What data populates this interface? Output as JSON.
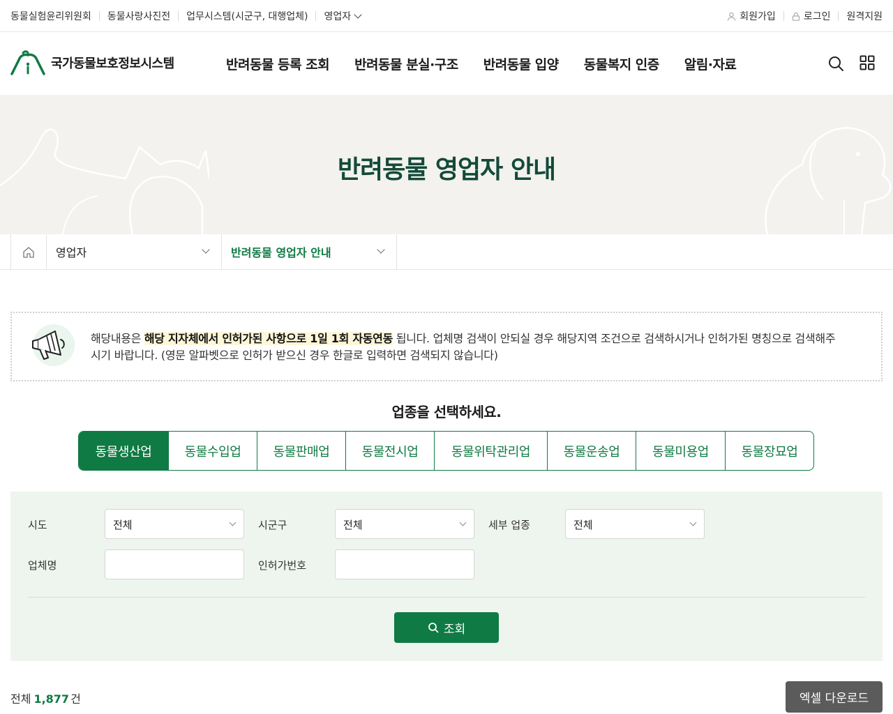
{
  "utility": {
    "left": [
      "동물실험윤리위원회",
      "동물사랑사진전",
      "업무시스템(시군구, 대행업체)",
      "영업자"
    ],
    "right": [
      "회원가입",
      "로그인",
      "원격지원"
    ]
  },
  "header": {
    "logo_text": "국가동물보호정보시스템",
    "nav": [
      "반려동물 등록 조회",
      "반려동물 분실·구조",
      "반려동물 입양",
      "동물복지 인증",
      "알림·자료"
    ]
  },
  "visual": {
    "title": "반려동물 영업자 안내"
  },
  "location": {
    "depth1": "영업자",
    "depth2": "반려동물 영업자 안내"
  },
  "notice": {
    "before": "해당내용은 ",
    "highlight": "해당 지자체에서 인허가된 사항으로 1일 1회 자동연동",
    "after": " 됩니다. 업체명 검색이 안되실 경우 해당지역 조건으로 검색하시거나 인허가된 명칭으로 검색해주시기 바랍니다. (영문 알파벳으로 인허가 받으신 경우 한글로 입력하면 검색되지 않습니다)"
  },
  "types": {
    "title": "업종을 선택하세요.",
    "tabs": [
      "동물생산업",
      "동물수입업",
      "동물판매업",
      "동물전시업",
      "동물위탁관리업",
      "동물운송업",
      "동물미용업",
      "동물장묘업"
    ],
    "active_index": 0
  },
  "search": {
    "sido_label": "시도",
    "sido_value": "전체",
    "sigungu_label": "시군구",
    "sigungu_value": "전체",
    "detail_label": "세부 업종",
    "detail_value": "전체",
    "company_label": "업체명",
    "company_value": "",
    "license_label": "인허가번호",
    "license_value": "",
    "button": "조회"
  },
  "result": {
    "total_label": "전체",
    "total_count": "1,877",
    "total_unit": "건",
    "excel_button": "엑셀 다운로드"
  },
  "colors": {
    "primary": "#0f7a43",
    "title_dark": "#134a3a",
    "banner_bg": "#f3f2ee",
    "search_bg": "#eef5ef",
    "excel_bg": "#5b5b5b"
  }
}
